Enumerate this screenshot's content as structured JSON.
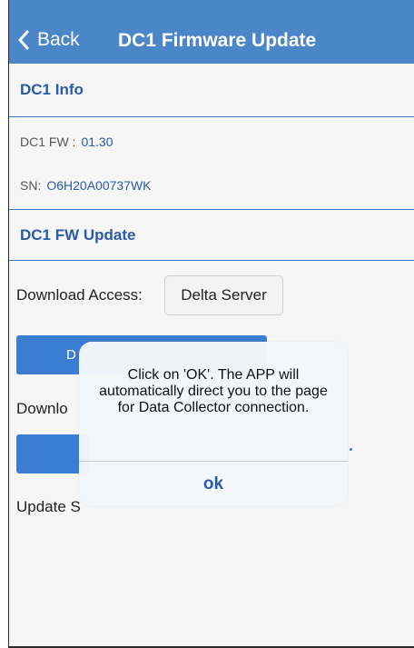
{
  "nav": {
    "back_label": "Back",
    "title": "DC1 Firmware Update"
  },
  "dc1_info": {
    "header": "DC1 Info",
    "fw_label": "DC1 FW :",
    "fw_value": "01.30",
    "sn_label": "SN:",
    "sn_value": "O6H20A00737WK"
  },
  "fw_update": {
    "header": "DC1 FW Update",
    "download_access_label": "Download Access:",
    "download_access_value": "Delta Server",
    "button1_visible_text": "D",
    "download_label_partial": "Downlo",
    "update_status_label_partial": "Update S"
  },
  "alert": {
    "message": "Click on 'OK'. The APP will automatically direct you to the page for Data Collector connection.",
    "ok_label": "ok"
  },
  "colors": {
    "nav_bg": "#4a86c8",
    "accent_blue": "#2a5aab",
    "button_blue": "#3b7dd0"
  },
  "icons": {
    "back": "chevron-left-icon"
  }
}
